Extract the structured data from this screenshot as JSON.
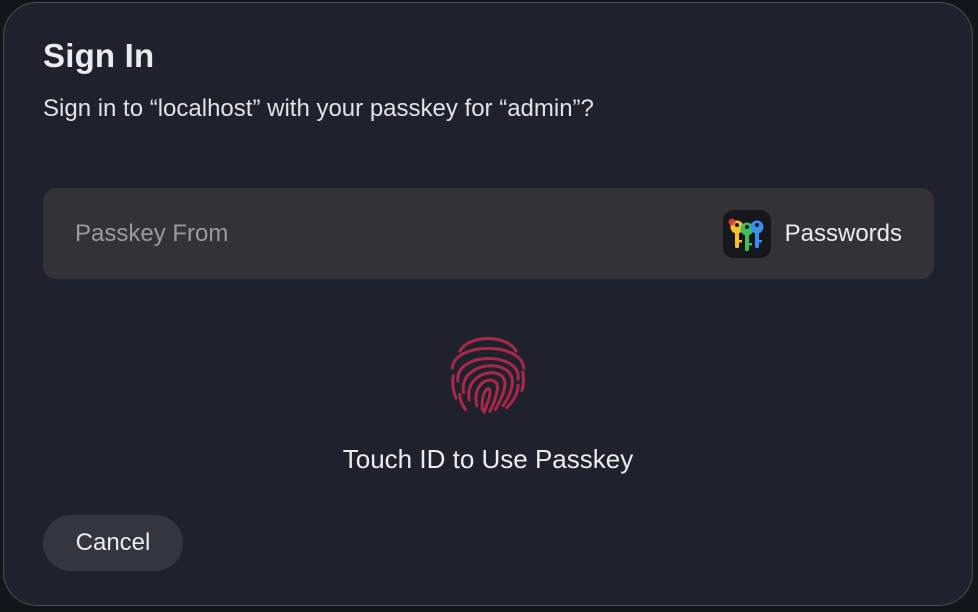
{
  "dialog": {
    "title": "Sign In",
    "subtitle": "Sign in to “localhost” with your passkey for “admin”?"
  },
  "source": {
    "label": "Passkey From",
    "provider_name": "Passwords",
    "provider_icon": "passwords-app-icon"
  },
  "touch": {
    "icon": "fingerprint-icon",
    "label": "Touch ID to Use Passkey",
    "color": "#a8284a"
  },
  "actions": {
    "cancel_label": "Cancel"
  }
}
